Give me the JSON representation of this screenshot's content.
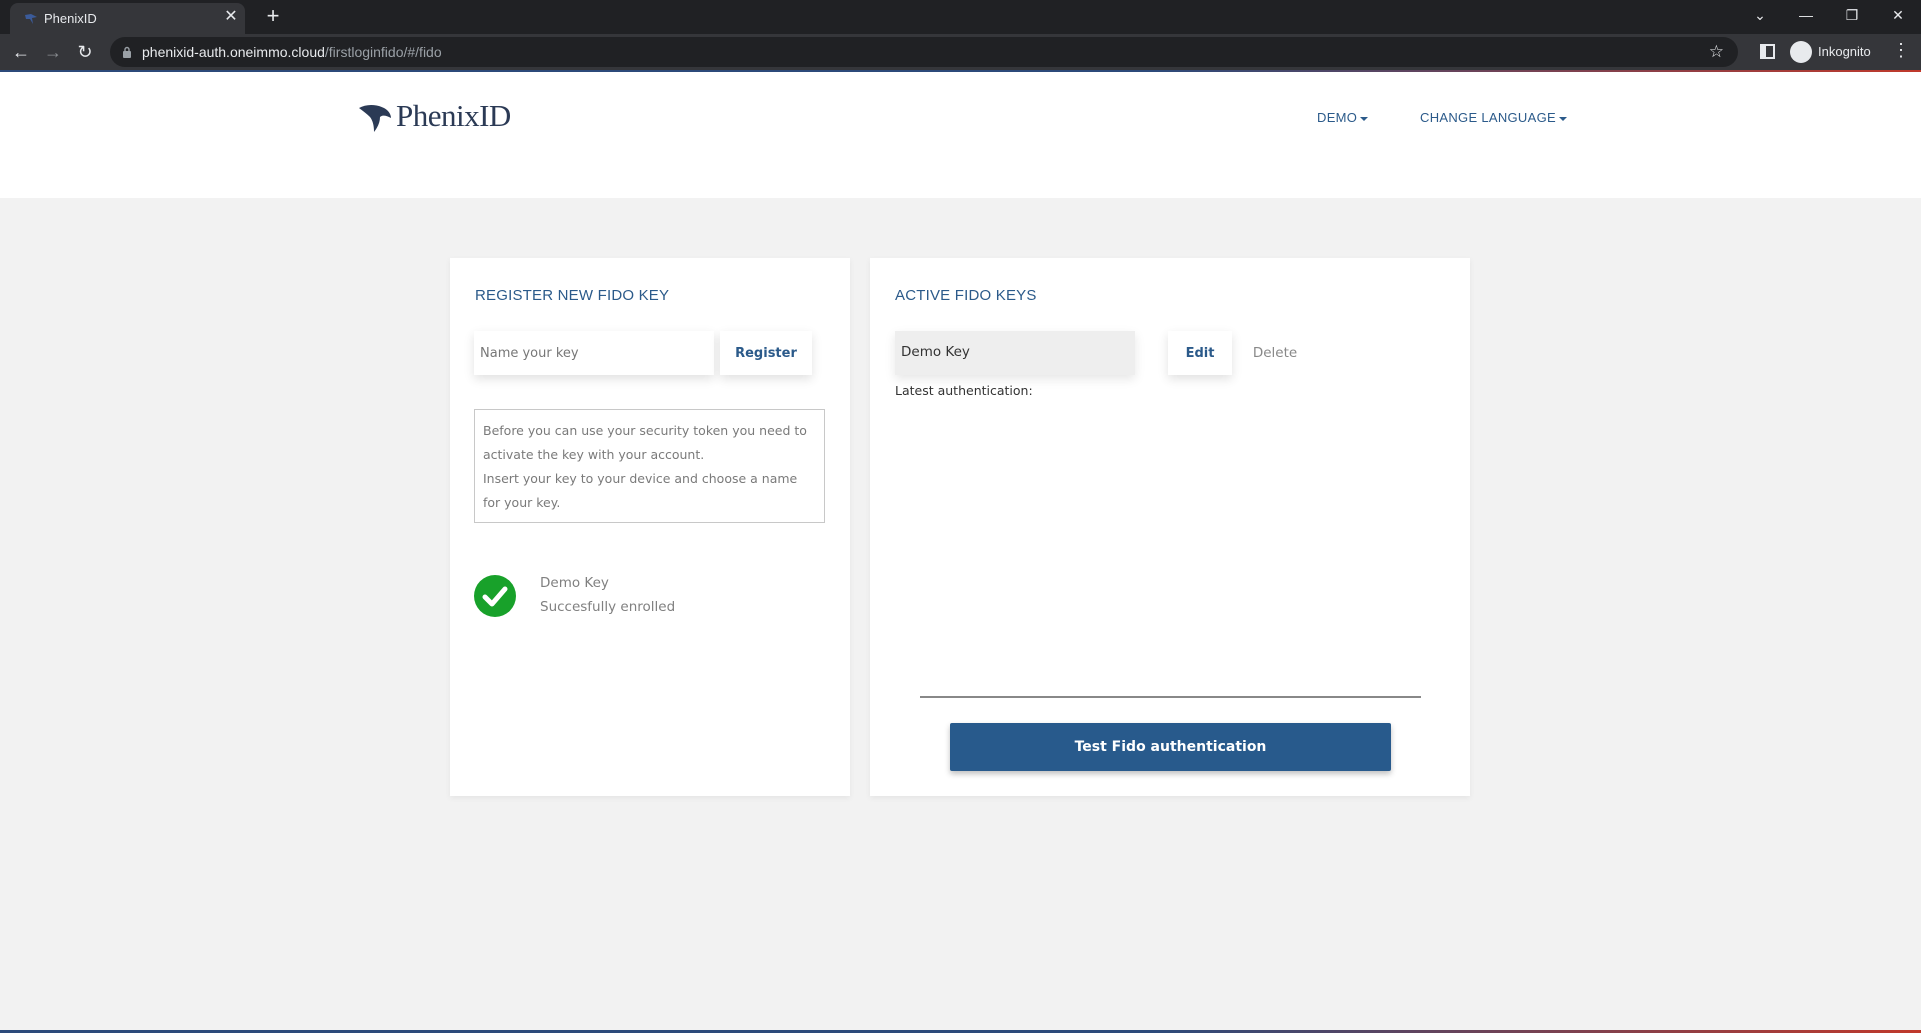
{
  "browser": {
    "tab_title": "PhenixID",
    "tab_close": "✕",
    "new_tab": "+",
    "url_host": "phenixid-auth.oneimmo.cloud",
    "url_path": "/firstloginfido/#/fido",
    "incognito_label": "Inkognito",
    "window_controls": {
      "list": "⌄",
      "minimize": "—",
      "restore": "❐",
      "close": "✕"
    },
    "nav": {
      "back": "←",
      "forward": "→",
      "reload": "↻"
    },
    "star": "☆",
    "menu": "⋮"
  },
  "header": {
    "logo_text": "PhenixID",
    "menu_demo": "DEMO",
    "menu_language": "CHANGE LANGUAGE",
    "brand_color": "#2b3a55",
    "link_color": "#2b5a8a"
  },
  "register": {
    "title": "REGISTER NEW FIDO KEY",
    "input_placeholder": "Name your key",
    "button_label": "Register",
    "info_line1": "Before you can use your security token you need to",
    "info_line2": "activate the key with your account.",
    "info_line3": "Insert your key to your device and choose a name",
    "info_line4": "for your key.",
    "enrolled_key_name": "Demo Key",
    "enrolled_status": "Succesfully enrolled",
    "success_color": "#18a12a"
  },
  "active": {
    "title": "ACTIVE FIDO KEYS",
    "key_name": "Demo Key",
    "edit_label": "Edit",
    "delete_label": "Delete",
    "latest_auth_label": "Latest authentication:",
    "test_button_label": "Test Fido authentication",
    "primary_color": "#285a8c"
  }
}
